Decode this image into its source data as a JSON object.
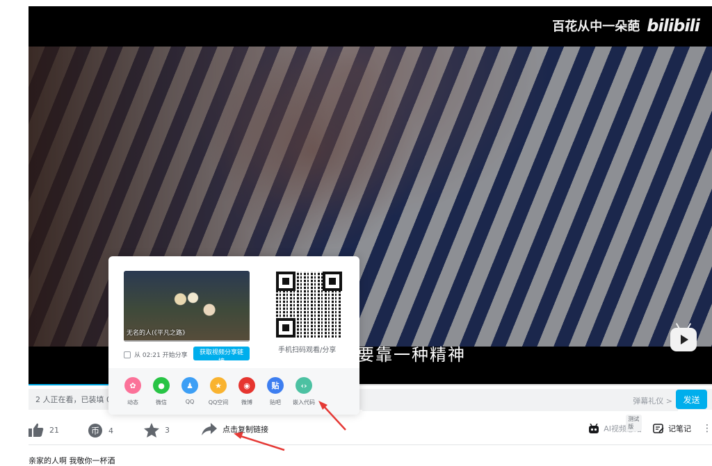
{
  "player": {
    "watermark_text": "百花从中一朵葩",
    "watermark_logo": "bilibili",
    "subtitle": "要靠一种精神",
    "progress_fraction": 0.36
  },
  "danmaku": {
    "status": "2 人正在看，已装填 0 条",
    "etiquette": "弹幕礼仪 >",
    "send_label": "发送"
  },
  "toolbar": {
    "like_count": "21",
    "coin_count": "4",
    "favorite_count": "3",
    "share_label": "点击复制链接",
    "ai_summary_label": "AI视频总结",
    "ai_badge": "测试版",
    "notes_label": "记笔记",
    "more_icon": "more-dots-icon"
  },
  "description_line": "亲家的人啊 我敬你一杯酒",
  "share_popup": {
    "thumb_title": "无名的人(《平凡之路》",
    "start_at_label": "从 02:21 开始分享",
    "copy_link_button": "获取视频分享链接",
    "qr_caption": "手机扫码观看/分享",
    "targets": [
      {
        "label": "动态",
        "icon": "dynamic-icon",
        "color": "#fb7299"
      },
      {
        "label": "微信",
        "icon": "wechat-icon",
        "color": "#28c445"
      },
      {
        "label": "QQ",
        "icon": "qq-icon",
        "color": "#3d9ff5"
      },
      {
        "label": "QQ空间",
        "icon": "qzone-icon",
        "color": "#f9b330"
      },
      {
        "label": "微博",
        "icon": "weibo-icon",
        "color": "#e6352f"
      },
      {
        "label": "贴吧",
        "icon": "tieba-icon",
        "color": "#3d7ef0"
      },
      {
        "label": "嵌入代码",
        "icon": "embed-code-icon",
        "color": "#4cc1a2"
      }
    ]
  },
  "colors": {
    "accent": "#00aeec",
    "annotation_arrow": "#e53935"
  }
}
